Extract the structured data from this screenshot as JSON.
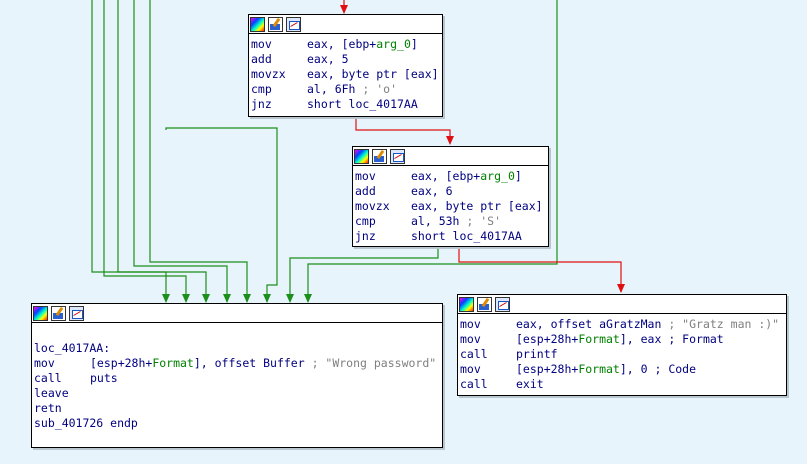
{
  "nodes": {
    "block1": {
      "lines": [
        {
          "m": "mov",
          "parts": [
            {
              "t": "eax, [ebp+"
            },
            {
              "t": "arg_0",
              "c": "sym"
            },
            {
              "t": "]"
            }
          ]
        },
        {
          "m": "add",
          "parts": [
            {
              "t": "eax, 5"
            }
          ]
        },
        {
          "m": "movzx",
          "parts": [
            {
              "t": "eax, byte ptr [eax]"
            }
          ]
        },
        {
          "m": "cmp",
          "parts": [
            {
              "t": "al, 6Fh"
            },
            {
              "t": " ; 'o'",
              "c": "cmt"
            }
          ]
        },
        {
          "m": "jnz",
          "parts": [
            {
              "t": "short loc_4017AA"
            }
          ]
        }
      ]
    },
    "block2": {
      "lines": [
        {
          "m": "mov",
          "parts": [
            {
              "t": "eax, [ebp+"
            },
            {
              "t": "arg_0",
              "c": "sym"
            },
            {
              "t": "]"
            }
          ]
        },
        {
          "m": "add",
          "parts": [
            {
              "t": "eax, 6"
            }
          ]
        },
        {
          "m": "movzx",
          "parts": [
            {
              "t": "eax, byte ptr [eax]"
            }
          ]
        },
        {
          "m": "cmp",
          "parts": [
            {
              "t": "al, 53h"
            },
            {
              "t": " ; 'S'",
              "c": "cmt"
            }
          ]
        },
        {
          "m": "jnz",
          "parts": [
            {
              "t": "short loc_4017AA"
            }
          ]
        }
      ]
    },
    "block3": {
      "lines": [
        {
          "blank": true
        },
        {
          "label": "loc_4017AA:"
        },
        {
          "m": "mov",
          "parts": [
            {
              "t": "[esp+28h+"
            },
            {
              "t": "Format",
              "c": "sym"
            },
            {
              "t": "], offset Buffer"
            },
            {
              "t": " ; \"Wrong password\"",
              "c": "cmt"
            }
          ]
        },
        {
          "m": "call",
          "parts": [
            {
              "t": "puts"
            }
          ]
        },
        {
          "m": "leave",
          "parts": []
        },
        {
          "m": "retn",
          "parts": []
        },
        {
          "label": "sub_401726 endp"
        }
      ]
    },
    "block4": {
      "lines": [
        {
          "m": "mov",
          "parts": [
            {
              "t": "eax, offset aGratzMan"
            },
            {
              "t": " ; \"Gratz man :)\"",
              "c": "cmt"
            }
          ]
        },
        {
          "m": "mov",
          "parts": [
            {
              "t": "[esp+28h+"
            },
            {
              "t": "Format",
              "c": "sym"
            },
            {
              "t": "], eax ; Format"
            }
          ]
        },
        {
          "m": "call",
          "parts": [
            {
              "t": "printf"
            }
          ]
        },
        {
          "m": "mov",
          "parts": [
            {
              "t": "[esp+28h+"
            },
            {
              "t": "Format",
              "c": "sym"
            },
            {
              "t": "], 0 ; Code"
            }
          ]
        },
        {
          "m": "call",
          "parts": [
            {
              "t": "exit"
            }
          ]
        }
      ]
    }
  },
  "edge_colors": {
    "false_branch": "#1a8f1a",
    "true_branch": "#e01010"
  }
}
